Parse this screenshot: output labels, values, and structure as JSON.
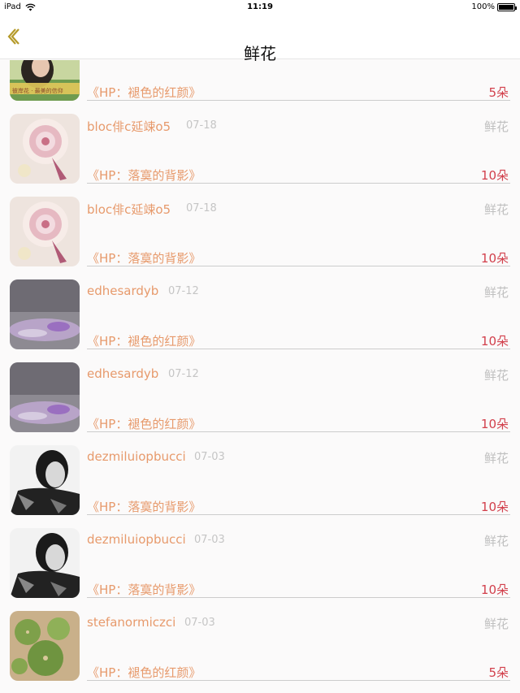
{
  "status_bar": {
    "device": "iPad",
    "time": "11:19",
    "battery": "100%"
  },
  "nav": {
    "title": "鲜花"
  },
  "gift_type_label": "鲜花",
  "partial_row": {
    "book": "《HP：褪色的红颜》",
    "amount": "5朵",
    "avatar_caption": "彼岸花 ‧ 最美的信仰"
  },
  "rows": [
    {
      "name": "bloc俳c延竦o5",
      "date": "07-18",
      "book": "《HP：落寞的背影》",
      "amount": "10朵",
      "avatar": "lollipop"
    },
    {
      "name": "bloc俳c延竦o5",
      "date": "07-18",
      "book": "《HP：落寞的背影》",
      "amount": "10朵",
      "avatar": "lollipop"
    },
    {
      "name": "edhesardyb",
      "date": "07-12",
      "book": "《HP：褪色的红颜》",
      "amount": "10朵",
      "avatar": "purple-blur"
    },
    {
      "name": "edhesardyb",
      "date": "07-12",
      "book": "《HP：褪色的红颜》",
      "amount": "10朵",
      "avatar": "purple-blur"
    },
    {
      "name": "dezmiluiopbucci",
      "date": "07-03",
      "book": "《HP：落寞的背影》",
      "amount": "10朵",
      "avatar": "bw-portrait"
    },
    {
      "name": "dezmiluiopbucci",
      "date": "07-03",
      "book": "《HP：落寞的背影》",
      "amount": "10朵",
      "avatar": "bw-portrait"
    },
    {
      "name": "stefanormiczci",
      "date": "07-03",
      "book": "《HP：褪色的红颜》",
      "amount": "5朵",
      "avatar": "cactus"
    }
  ],
  "colors": {
    "name": "#e79a6c",
    "amount": "#d2404c",
    "date": "#c5c5c5",
    "gift": "#bfbfbf",
    "back": "#b59a2a"
  }
}
